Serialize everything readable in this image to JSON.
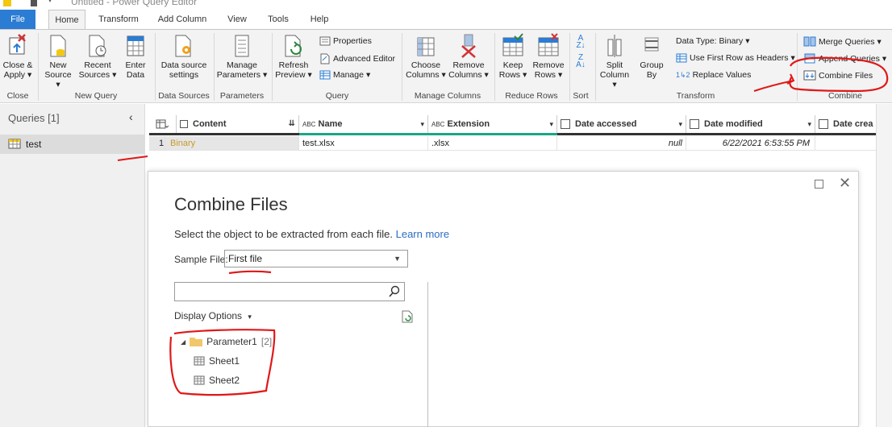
{
  "window": {
    "title": "Untitled - Power Query Editor"
  },
  "tabs": [
    "File",
    "Home",
    "Transform",
    "Add Column",
    "View",
    "Tools",
    "Help"
  ],
  "ribbon": {
    "close_apply": [
      "Close &",
      "Apply"
    ],
    "new_source": [
      "New",
      "Source"
    ],
    "recent_sources": [
      "Recent",
      "Sources"
    ],
    "enter_data": [
      "Enter",
      "Data"
    ],
    "data_source_settings": [
      "Data source",
      "settings"
    ],
    "manage_parameters": [
      "Manage",
      "Parameters"
    ],
    "refresh_preview": [
      "Refresh",
      "Preview"
    ],
    "properties": "Properties",
    "advanced_editor": "Advanced Editor",
    "manage": "Manage",
    "choose_columns": [
      "Choose",
      "Columns"
    ],
    "remove_columns": [
      "Remove",
      "Columns"
    ],
    "keep_rows": [
      "Keep",
      "Rows"
    ],
    "remove_rows": [
      "Remove",
      "Rows"
    ],
    "split_column": [
      "Split",
      "Column"
    ],
    "group_by": [
      "Group",
      "By"
    ],
    "data_type": "Data Type: Binary",
    "use_first_row": "Use First Row as Headers",
    "replace_values": "Replace Values",
    "merge_queries": "Merge Queries",
    "append_queries": "Append Queries",
    "combine_files": "Combine Files",
    "groups": {
      "close": "Close",
      "new_query": "New Query",
      "data_sources": "Data Sources",
      "parameters": "Parameters",
      "query": "Query",
      "manage_columns": "Manage Columns",
      "reduce_rows": "Reduce Rows",
      "sort": "Sort",
      "transform": "Transform",
      "combine": "Combine"
    }
  },
  "queries": {
    "title": "Queries [1]",
    "items": [
      "test"
    ]
  },
  "grid": {
    "columns": [
      {
        "type": "",
        "label": "Content"
      },
      {
        "type": "ABC",
        "label": "Name"
      },
      {
        "type": "ABC",
        "label": "Extension"
      },
      {
        "type": "",
        "label": "Date accessed"
      },
      {
        "type": "",
        "label": "Date modified"
      },
      {
        "type": "",
        "label": "Date crea"
      }
    ],
    "row": {
      "index": "1",
      "content": "Binary",
      "name": "test.xlsx",
      "extension": ".xlsx",
      "date_accessed": "null",
      "date_modified": "6/22/2021 6:53:55 PM"
    }
  },
  "dialog": {
    "title": "Combine Files",
    "description": "Select the object to be extracted from each file.",
    "learn_more": "Learn more",
    "sample_file_label": "Sample File:",
    "sample_file_value": "First file",
    "display_options": "Display Options",
    "tree": {
      "parameter": "Parameter1",
      "parameter_count": "[2]",
      "children": [
        "Sheet1",
        "Sheet2"
      ]
    }
  },
  "colors": {
    "accent": "#2b7cd3",
    "binary_text": "#c79a2a",
    "annotation": "#e01818",
    "header_bar_green": "#1aa786",
    "header_bar_dark": "#333333"
  }
}
